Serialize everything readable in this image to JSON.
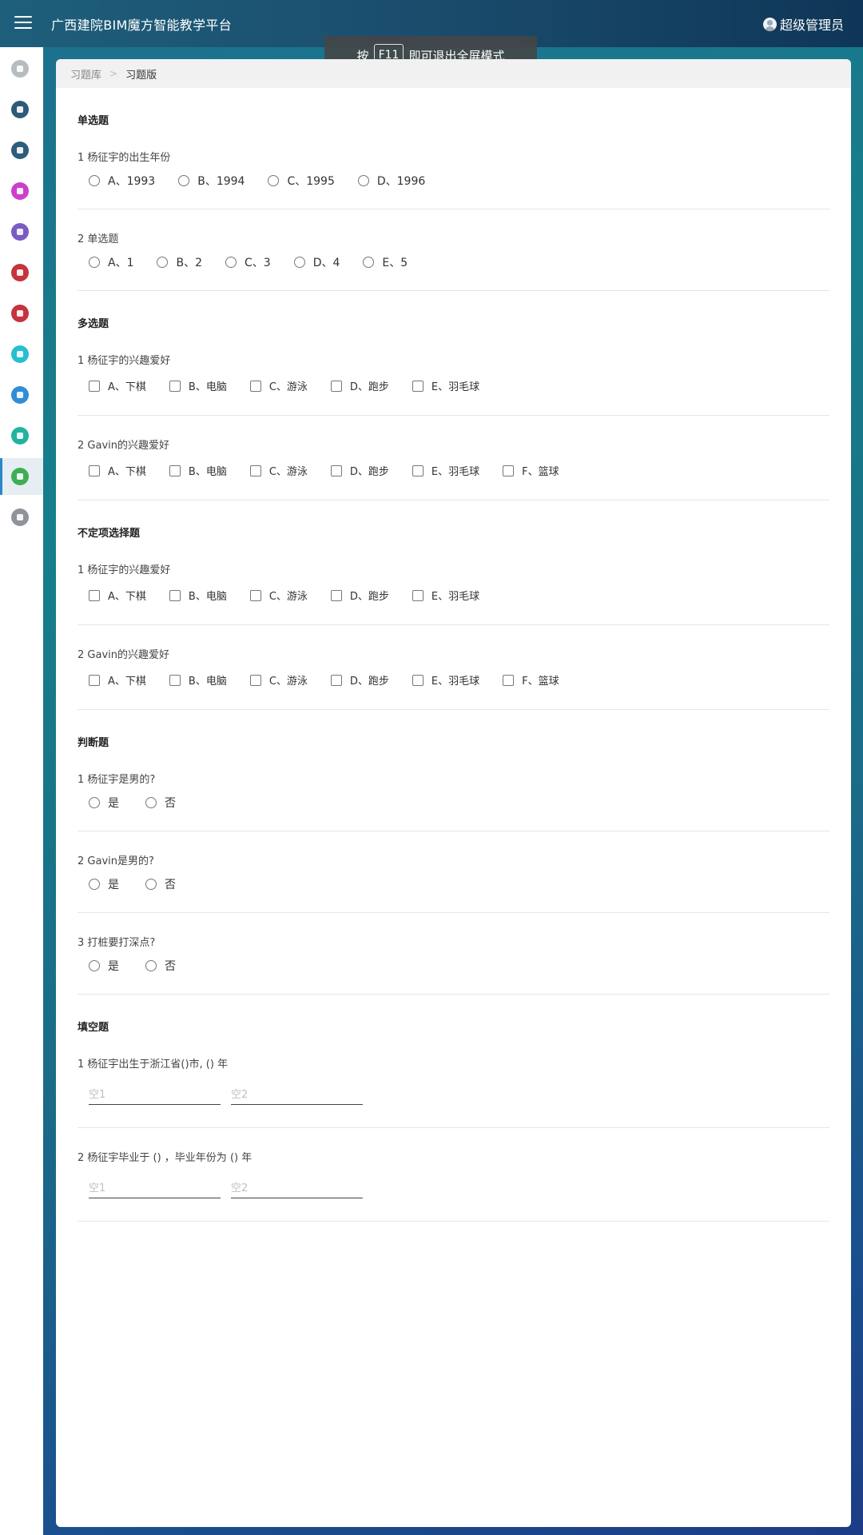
{
  "header": {
    "app_title": "广西建院BIM魔方智能教学平台",
    "user_name": "超级管理员"
  },
  "toast": {
    "prefix": "按",
    "key": "F11",
    "suffix": "即可退出全屏模式"
  },
  "sidebar": {
    "items": [
      {
        "name": "home-icon",
        "color": "#b5bcc2"
      },
      {
        "name": "document-settings-icon",
        "color": "#2e5a7a"
      },
      {
        "name": "gear-icon",
        "color": "#2c5d7b"
      },
      {
        "name": "bell-icon",
        "color": "#cc3fcc"
      },
      {
        "name": "user-icon",
        "color": "#7b5cc4"
      },
      {
        "name": "building-icon",
        "color": "#c5333d"
      },
      {
        "name": "building-icon",
        "color": "#c5333d"
      },
      {
        "name": "crown-icon",
        "color": "#27bfcf"
      },
      {
        "name": "chat-icon",
        "color": "#2f8ed8"
      },
      {
        "name": "leaf-icon",
        "color": "#21b3a0"
      },
      {
        "name": "list-icon",
        "color": "#3fae55"
      },
      {
        "name": "disk-icon",
        "color": "#8e949a"
      }
    ],
    "active_index": 10
  },
  "breadcrumb": {
    "parent": "习题库",
    "current": "习题版"
  },
  "sections": {
    "single": {
      "title": "单选题",
      "questions": [
        {
          "title": "1 杨征宇的出生年份",
          "options": [
            "A、1993",
            "B、1994",
            "C、1995",
            "D、1996"
          ]
        },
        {
          "title": "2 单选题",
          "options": [
            "A、1",
            "B、2",
            "C、3",
            "D、4",
            "E、5"
          ]
        }
      ]
    },
    "multi": {
      "title": "多选题",
      "questions": [
        {
          "title": "1 杨征宇的兴趣爱好",
          "options": [
            "A、下棋",
            "B、电脑",
            "C、游泳",
            "D、跑步",
            "E、羽毛球"
          ]
        },
        {
          "title": "2 Gavin的兴趣爱好",
          "options": [
            "A、下棋",
            "B、电脑",
            "C、游泳",
            "D、跑步",
            "E、羽毛球",
            "F、篮球"
          ]
        }
      ]
    },
    "indefinite": {
      "title": "不定项选择题",
      "questions": [
        {
          "title": "1 杨征宇的兴趣爱好",
          "options": [
            "A、下棋",
            "B、电脑",
            "C、游泳",
            "D、跑步",
            "E、羽毛球"
          ]
        },
        {
          "title": "2 Gavin的兴趣爱好",
          "options": [
            "A、下棋",
            "B、电脑",
            "C、游泳",
            "D、跑步",
            "E、羽毛球",
            "F、篮球"
          ]
        }
      ]
    },
    "judge": {
      "title": "判断题",
      "questions": [
        {
          "title": "1 杨征宇是男的?",
          "options": [
            "是",
            "否"
          ]
        },
        {
          "title": "2 Gavin是男的?",
          "options": [
            "是",
            "否"
          ]
        },
        {
          "title": "3 打桩要打深点?",
          "options": [
            "是",
            "否"
          ]
        }
      ]
    },
    "fill": {
      "title": "填空题",
      "questions": [
        {
          "title": "1 杨征宇出生于浙江省()市, () 年",
          "blanks": [
            "空1",
            "空2"
          ]
        },
        {
          "title": "2 杨征宇毕业于 () ，毕业年份为 () 年",
          "blanks": [
            "空1",
            "空2"
          ]
        }
      ]
    }
  }
}
